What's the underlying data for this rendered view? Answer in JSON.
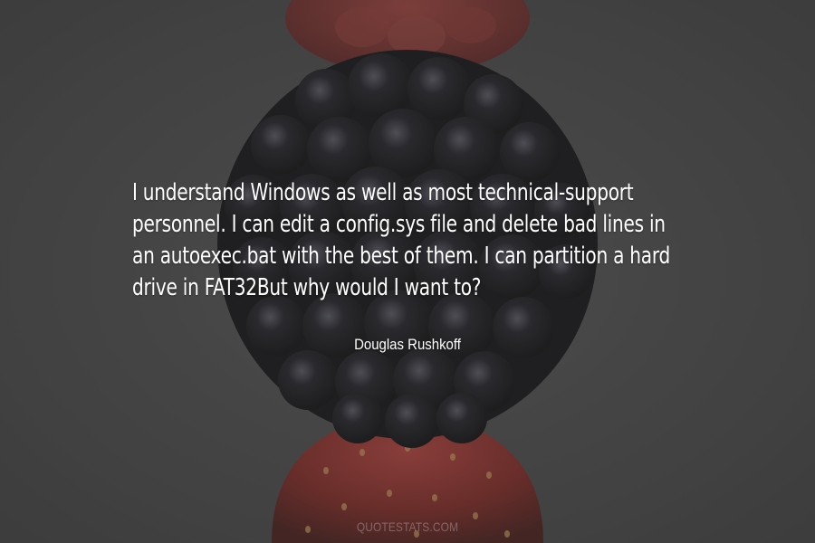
{
  "quote": {
    "lines": [
      "I understand Windows as well as most technical-support",
      "personnel. I can edit a config.sys file and delete bad lines in",
      "an autoexec.bat with the best of them. I can partition a hard",
      "drive in FAT32But why would I want to?"
    ]
  },
  "author": "Douglas Rushkoff",
  "watermark": "QUOTESTATS.COM",
  "colors": {
    "background": "#4a4a4a",
    "text": "#ffffff",
    "raspberry_top": "#8a2a2a",
    "blackberry": "#101014",
    "strawberry": "#9a2a22"
  }
}
